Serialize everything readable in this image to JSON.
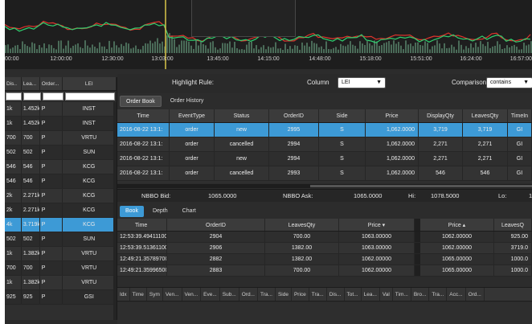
{
  "chart": {
    "time_labels": [
      "00:00",
      "12:00:00",
      "12:30:00",
      "13:03:00",
      "13:45:00",
      "14:15:00",
      "14:48:00",
      "15:18:00",
      "15:51:00",
      "16:24:00",
      "16:57:00"
    ],
    "colors": {
      "red": "#e0342c",
      "green": "#2fd16f",
      "bars": "#4a6b58",
      "cursor": "#d9c548"
    }
  },
  "left": {
    "headers": [
      "Dis..",
      "Lea...",
      "Order...",
      "LEI"
    ],
    "rows": [
      [
        "1k",
        "1.452k",
        "P",
        "INST"
      ],
      [
        "1k",
        "1.452k",
        "P",
        "INST"
      ],
      [
        "700",
        "700",
        "P",
        "VRTU"
      ],
      [
        "502",
        "502",
        "P",
        "SUN"
      ],
      [
        "546",
        "546",
        "P",
        "KCG"
      ],
      [
        "546",
        "546",
        "P",
        "KCG"
      ],
      [
        "2k",
        "2.271k",
        "P",
        "KCG"
      ],
      [
        "2k",
        "2.271k",
        "P",
        "KCG"
      ],
      [
        "4k",
        "3.719k",
        "P",
        "KCG"
      ],
      [
        "502",
        "502",
        "P",
        "SUN"
      ],
      [
        "1k",
        "1.382k",
        "P",
        "VRTU"
      ],
      [
        "700",
        "700",
        "P",
        "VRTU"
      ],
      [
        "1k",
        "1.382k",
        "P",
        "VRTU"
      ],
      [
        "925",
        "925",
        "P",
        "GSI"
      ]
    ],
    "selected_row": 8
  },
  "highlight": {
    "rule_label": "Highlight Rule:",
    "column_label": "Column",
    "column_value": "LEI",
    "comparison_label": "Comparison:",
    "comparison_value": "contains"
  },
  "order_tabs": [
    "Order Book",
    "Order History"
  ],
  "orders": {
    "headers": [
      "Time",
      "EventType",
      "Status",
      "OrderID",
      "Side",
      "Price",
      "DisplayQty",
      "LeavesQty",
      "TimeIn"
    ],
    "rows": [
      [
        "2016-08-22 13:1:",
        "order",
        "new",
        "2995",
        "S",
        "1,062.0000",
        "3,719",
        "3,719",
        "GI"
      ],
      [
        "2016-08-22 13:1:",
        "order",
        "cancelled",
        "2994",
        "S",
        "1,062.0000",
        "2,271",
        "2,271",
        "GI"
      ],
      [
        "2016-08-22 13:1:",
        "order",
        "new",
        "2994",
        "S",
        "1,062.0000",
        "2,271",
        "2,271",
        "GI"
      ],
      [
        "2016-08-22 13:1:",
        "order",
        "cancelled",
        "2993",
        "S",
        "1,062.0000",
        "546",
        "546",
        "GI"
      ]
    ],
    "selected_row": 0
  },
  "nbbo": {
    "bid_label": "NBBO Bid:",
    "bid_value": "1065.0000",
    "ask_label": "NBBO Ask:",
    "ask_value": "1065.0000",
    "hi_label": "Hi:",
    "hi_value": "1078.5000",
    "lo_label": "Lo:",
    "lo_value": "1"
  },
  "book_tabs": [
    "Book",
    "Depth",
    "Chart"
  ],
  "book": {
    "headers": [
      "Time",
      "OrderID",
      "LeavesQty",
      "Price ▾",
      "Price ▴",
      "LeavesQ"
    ],
    "rows": [
      [
        "12:53:39.494111000",
        "2904",
        "700.00",
        "1063.00000",
        "1062.00000",
        "925.00"
      ],
      [
        "12:53:39.513611000",
        "2906",
        "1382.00",
        "1063.00000",
        "1062.00000",
        "3719.0"
      ],
      [
        "12:49:21.357897000",
        "2882",
        "1382.00",
        "1062.00000",
        "1065.00000",
        "1000.0"
      ],
      [
        "12:49:21.359965000",
        "2883",
        "700.00",
        "1062.00000",
        "1065.00000",
        "1000.0"
      ]
    ]
  },
  "bottom_columns": [
    "Idx",
    "Time",
    "Sym",
    "Ven...",
    "Ven...",
    "Eve...",
    "Sub...",
    "Ord...",
    "Tra...",
    "Side",
    "Price",
    "Tra...",
    "Dis...",
    "Tot...",
    "Lea...",
    "Val",
    "Tim...",
    "Bro...",
    "Tra...",
    "Acc...",
    "Ord..."
  ]
}
